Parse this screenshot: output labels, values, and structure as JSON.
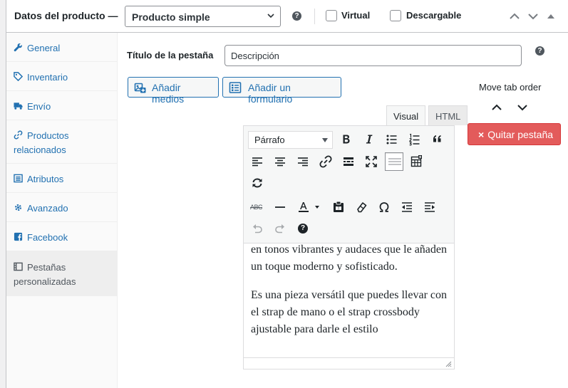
{
  "header": {
    "title": "Datos del producto —",
    "product_type": "Producto simple",
    "help": "?",
    "virtual_label": "Virtual",
    "downloadable_label": "Descargable"
  },
  "sidebar": {
    "items": [
      {
        "label": "General",
        "icon": "wrench-icon"
      },
      {
        "label": "Inventario",
        "icon": "tag-icon"
      },
      {
        "label": "Envío",
        "icon": "truck-icon"
      },
      {
        "label_line1": "Productos",
        "label_line2": "relacionados",
        "icon": "link-icon"
      },
      {
        "label": "Atributos",
        "icon": "list-icon"
      },
      {
        "label": "Avanzado",
        "icon": "gear-icon"
      },
      {
        "label": "Facebook",
        "icon": "facebook-icon"
      },
      {
        "label_line1": "Pestañas",
        "label_line2": "personalizadas",
        "icon": "tabs-icon"
      }
    ]
  },
  "tab_editor": {
    "title_label": "Título de la pestaña",
    "title_value": "Descripción",
    "add_media_label": "Añadir medios",
    "add_form_label": "Añadir un formulario",
    "move_label": "Move tab order",
    "remove_label": "Quitar pestaña",
    "remove_icon": "×",
    "tab_visual": "Visual",
    "tab_html": "HTML",
    "format_value": "Párrafo",
    "strike_abbr": "ABC",
    "help": "?",
    "paragraph1": "en tonos vibrantes y audaces que le añaden un toque moderno y sofisticado.",
    "paragraph2": "Es una pieza versátil que puedes llevar con el strap de mano o el strap crossbody ajustable para darle el estilo"
  },
  "colors": {
    "link": "#2271b1",
    "danger": "#e35b5b",
    "border": "#c3c4c7"
  }
}
